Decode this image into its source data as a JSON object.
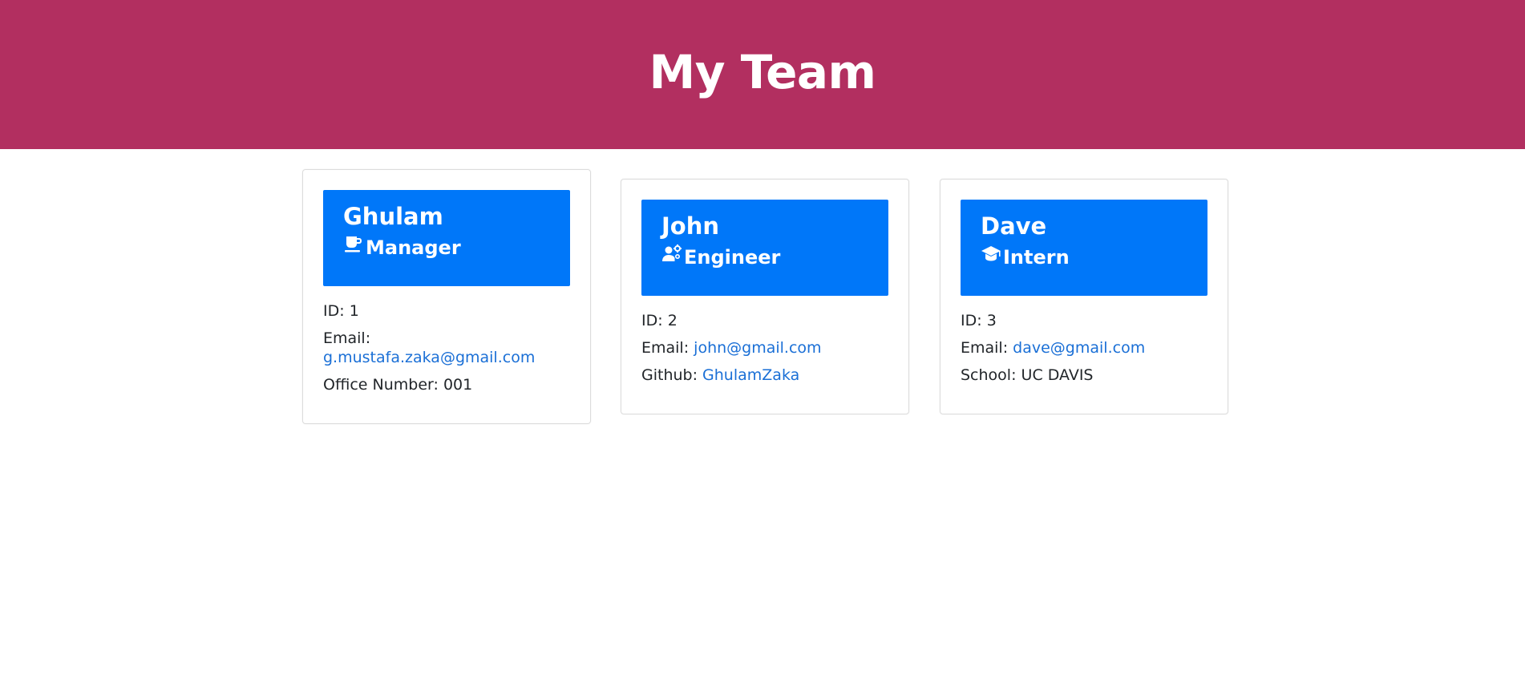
{
  "header": {
    "title": "My Team"
  },
  "colors": {
    "jumbotron_bg": "#b22f60",
    "card_header_bg": "#0077f9",
    "link": "#1a6fd6"
  },
  "team": [
    {
      "name": "Ghulam",
      "role": "Manager",
      "role_icon": "coffee-mug-icon",
      "id_label": "ID:",
      "id": "1",
      "email_label": "Email:",
      "email": "g.mustafa.zaka@gmail.com",
      "extra_label": "Office Number:",
      "extra_value": "001"
    },
    {
      "name": "John",
      "role": "Engineer",
      "role_icon": "user-cog-icon",
      "id_label": "ID:",
      "id": "2",
      "email_label": "Email:",
      "email": "john@gmail.com",
      "extra_label": "Github:",
      "extra_value": "GhulamZaka"
    },
    {
      "name": "Dave",
      "role": "Intern",
      "role_icon": "graduation-cap-icon",
      "id_label": "ID:",
      "id": "3",
      "email_label": "Email:",
      "email": "dave@gmail.com",
      "extra_label": "School:",
      "extra_value": "UC DAVIS"
    }
  ]
}
